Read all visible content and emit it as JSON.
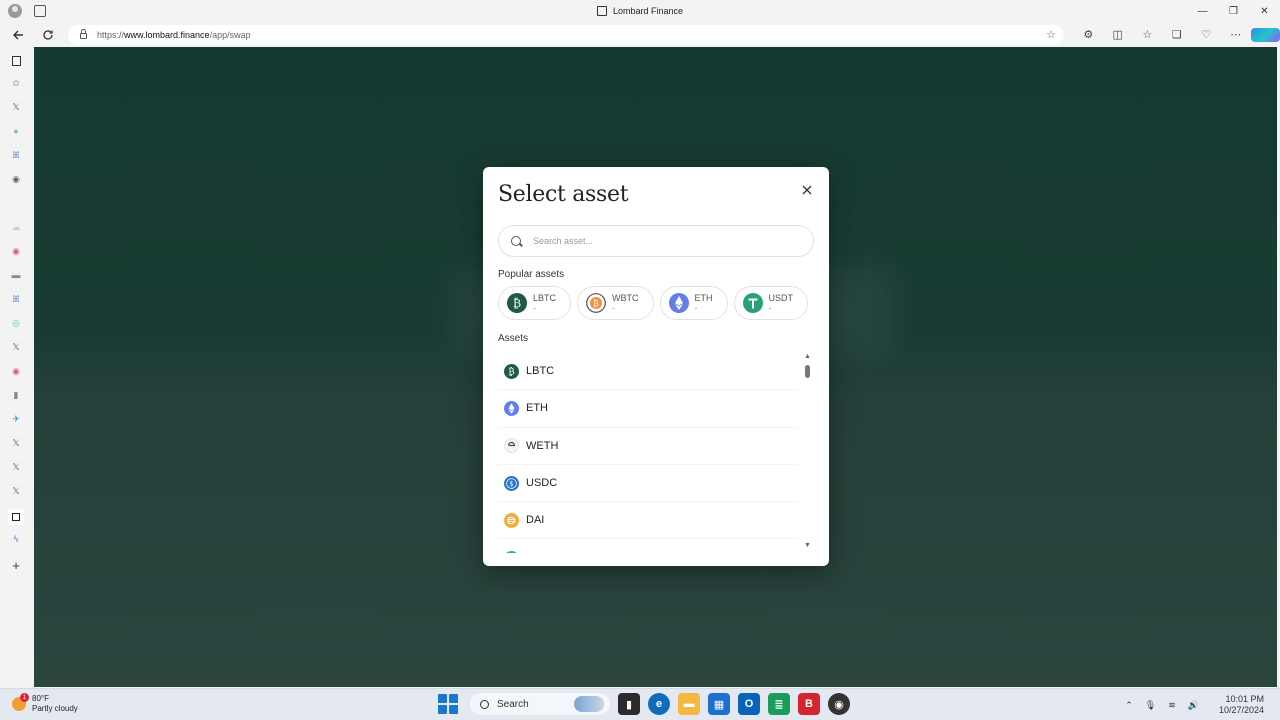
{
  "window": {
    "title": "Lombard Finance",
    "controls": [
      "—",
      "❐",
      "✕"
    ]
  },
  "browser": {
    "url_prefix": "https://",
    "url_host": "www.lombard.finance",
    "url_path": "/app/swap"
  },
  "modal": {
    "title": "Select asset",
    "search_placeholder": "Search asset...",
    "popular_label": "Popular assets",
    "assets_label": "Assets",
    "popular": [
      {
        "symbol": "LBTC",
        "balance": "-",
        "color": "#1f5a45",
        "glyph": "₿"
      },
      {
        "symbol": "WBTC",
        "balance": "-",
        "color": "#f09242",
        "glyph": "₿"
      },
      {
        "symbol": "ETH",
        "balance": "-",
        "color": "#627eea",
        "glyph": "◆"
      },
      {
        "symbol": "USDT",
        "balance": "-",
        "color": "#26a17b",
        "glyph": "T"
      }
    ],
    "assets": [
      {
        "symbol": "LBTC",
        "color": "#1f5a45",
        "glyph": "₿"
      },
      {
        "symbol": "ETH",
        "color": "#627eea",
        "glyph": "◆"
      },
      {
        "symbol": "WETH",
        "color": "#444444",
        "glyph": "e"
      },
      {
        "symbol": "USDC",
        "color": "#2775ca",
        "glyph": "$"
      },
      {
        "symbol": "DAI",
        "color": "#f5ac37",
        "glyph": "≡"
      }
    ]
  },
  "taskbar": {
    "weather_temp": "80°F",
    "weather_desc": "Partly cloudy",
    "weather_badge": "1",
    "search_label": "Search",
    "time": "10:01 PM",
    "date": "10/27/2024"
  }
}
